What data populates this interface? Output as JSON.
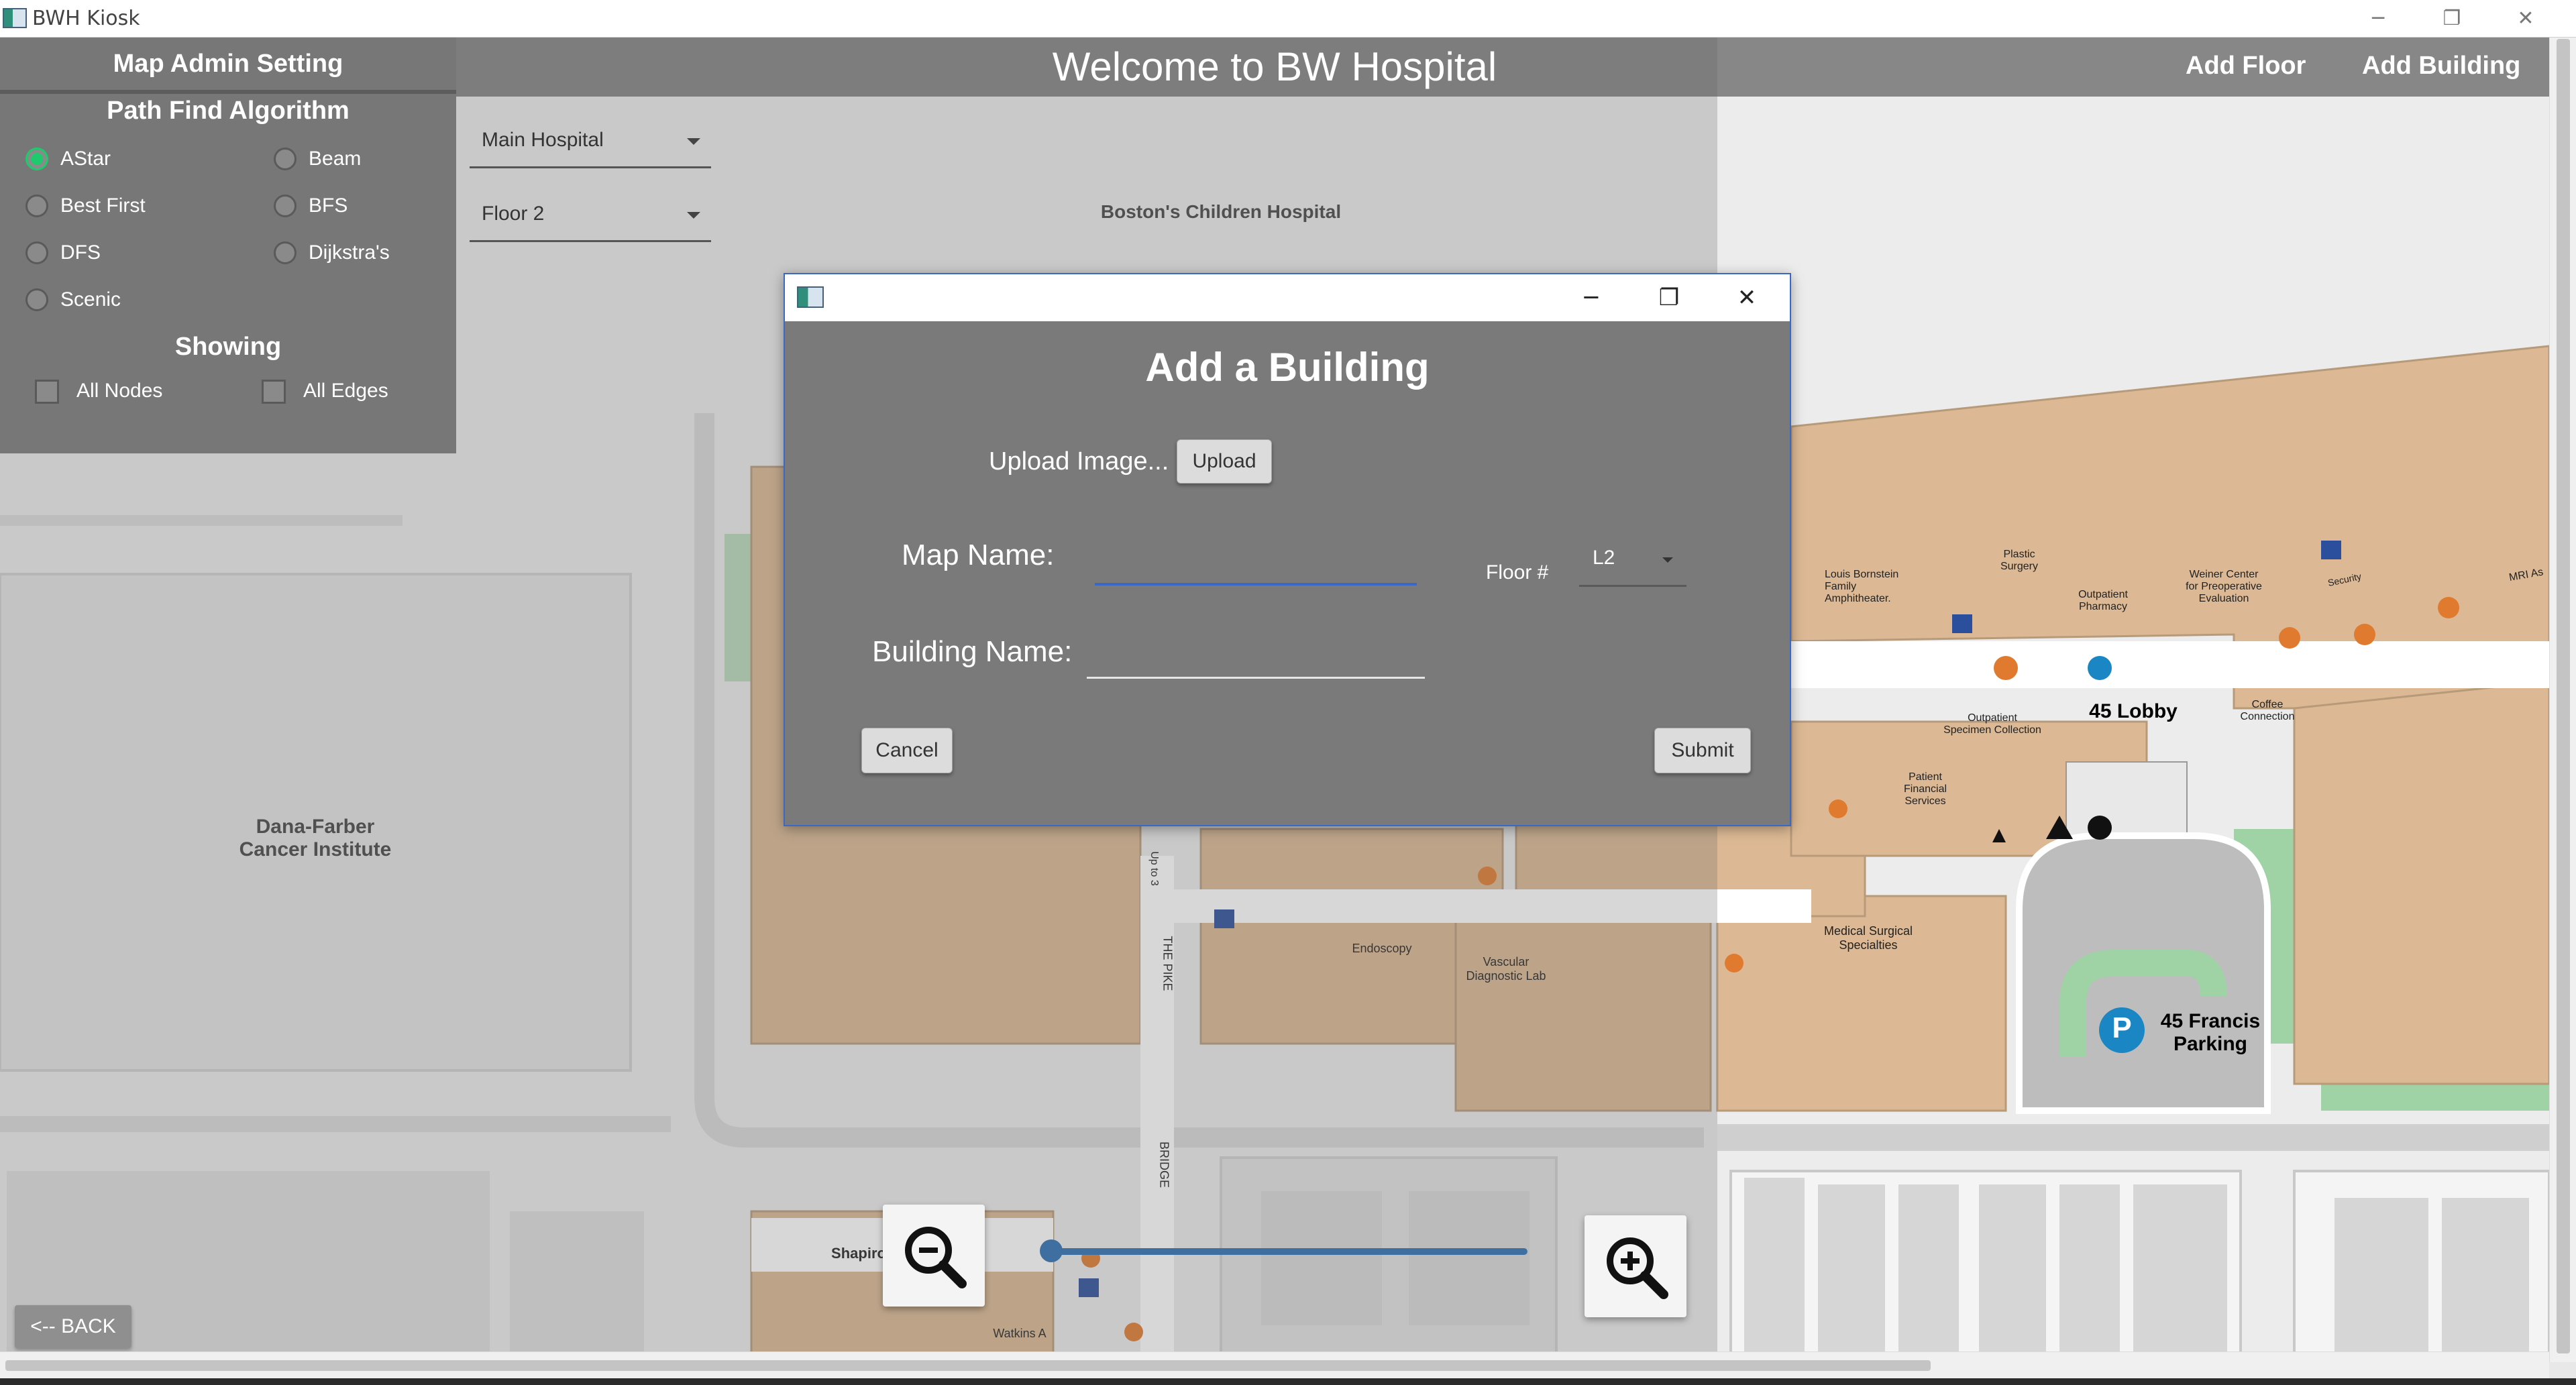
{
  "window": {
    "title": "BWH Kiosk",
    "controls": {
      "minimize": "─",
      "restore": "❐",
      "close": "✕"
    }
  },
  "header": {
    "title": "Welcome to BW Hospital",
    "add_floor": "Add Floor",
    "add_building": "Add Building"
  },
  "admin_panel": {
    "title": "Map Admin Setting",
    "path_find_title": "Path Find Algorithm",
    "algorithms": [
      {
        "label": "AStar",
        "selected": true
      },
      {
        "label": "Beam",
        "selected": false
      },
      {
        "label": "Best First",
        "selected": false
      },
      {
        "label": "BFS",
        "selected": false
      },
      {
        "label": "DFS",
        "selected": false
      },
      {
        "label": "Dijkstra's",
        "selected": false
      },
      {
        "label": "Scenic",
        "selected": false
      }
    ],
    "showing_title": "Showing",
    "all_nodes": "All Nodes",
    "all_edges": "All Edges"
  },
  "map_controls": {
    "building_select": "Main Hospital",
    "floor_select": "Floor 2",
    "back": "<-- BACK",
    "zoom_level": 0
  },
  "map_labels": {
    "boston_childrens": "Boston's Children Hospital",
    "dana_farber": "Dana-Farber\nCancer Institute",
    "lobby": "45 Lobby",
    "parking": "45 Francis\nParking",
    "parking_symbol": "P",
    "the_pike": "THE PIKE",
    "bridge": "BRIDGE",
    "shapiro": "Shapiro",
    "watkins": "Watkins A",
    "up_to_3": "Up to 3",
    "endoscopy": "Endoscopy",
    "vascular": "Vascular\nDiagnostic Lab",
    "medical_surgical": "Medical Surgical\nSpecialties",
    "plastic_surgery": "Plastic\nSurgery",
    "outpatient_pharmacy": "Outpatient\nPharmacy",
    "weiner_center": "Weiner Center\nfor Preoperative\nEvaluation",
    "louis_bornstein": "Louis Bornstein\nFamily\nAmphitheater.",
    "outpatient_specimen": "Outpatient\nSpecimen Collection",
    "patient_financial": "Patient\nFinancial\nServices",
    "coffee": "Coffee\nConnection",
    "security": "Security",
    "mri": "MRI As"
  },
  "dialog": {
    "title": "Add a Building",
    "upload_label": "Upload Image...",
    "upload_button": "Upload",
    "map_name_label": "Map Name:",
    "map_name_value": "",
    "floor_label": "Floor #",
    "floor_value": "L2",
    "building_name_label": "Building Name:",
    "building_name_value": "",
    "cancel": "Cancel",
    "submit": "Submit"
  },
  "colors": {
    "accent": "#3a68c6",
    "radio_selected": "#1ecb6c",
    "building": "#dcb994",
    "green_space": "#9fd3a5",
    "slider": "#3f6fa0"
  }
}
